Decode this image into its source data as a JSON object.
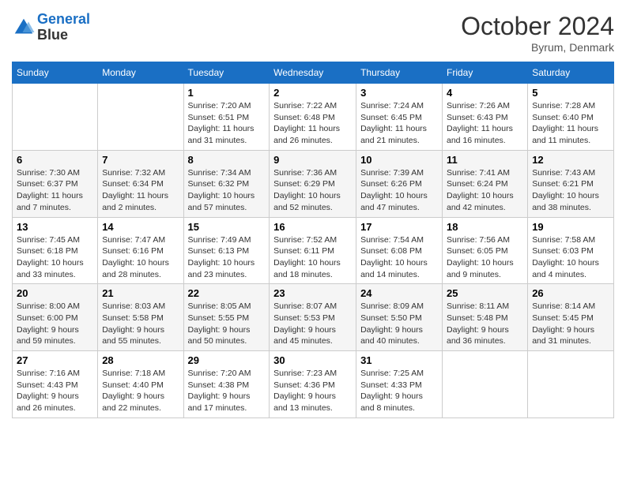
{
  "header": {
    "logo_line1": "General",
    "logo_line2": "Blue",
    "month_title": "October 2024",
    "location": "Byrum, Denmark"
  },
  "weekdays": [
    "Sunday",
    "Monday",
    "Tuesday",
    "Wednesday",
    "Thursday",
    "Friday",
    "Saturday"
  ],
  "weeks": [
    [
      {
        "day": "",
        "info": ""
      },
      {
        "day": "",
        "info": ""
      },
      {
        "day": "1",
        "info": "Sunrise: 7:20 AM\nSunset: 6:51 PM\nDaylight: 11 hours and 31 minutes."
      },
      {
        "day": "2",
        "info": "Sunrise: 7:22 AM\nSunset: 6:48 PM\nDaylight: 11 hours and 26 minutes."
      },
      {
        "day": "3",
        "info": "Sunrise: 7:24 AM\nSunset: 6:45 PM\nDaylight: 11 hours and 21 minutes."
      },
      {
        "day": "4",
        "info": "Sunrise: 7:26 AM\nSunset: 6:43 PM\nDaylight: 11 hours and 16 minutes."
      },
      {
        "day": "5",
        "info": "Sunrise: 7:28 AM\nSunset: 6:40 PM\nDaylight: 11 hours and 11 minutes."
      }
    ],
    [
      {
        "day": "6",
        "info": "Sunrise: 7:30 AM\nSunset: 6:37 PM\nDaylight: 11 hours and 7 minutes."
      },
      {
        "day": "7",
        "info": "Sunrise: 7:32 AM\nSunset: 6:34 PM\nDaylight: 11 hours and 2 minutes."
      },
      {
        "day": "8",
        "info": "Sunrise: 7:34 AM\nSunset: 6:32 PM\nDaylight: 10 hours and 57 minutes."
      },
      {
        "day": "9",
        "info": "Sunrise: 7:36 AM\nSunset: 6:29 PM\nDaylight: 10 hours and 52 minutes."
      },
      {
        "day": "10",
        "info": "Sunrise: 7:39 AM\nSunset: 6:26 PM\nDaylight: 10 hours and 47 minutes."
      },
      {
        "day": "11",
        "info": "Sunrise: 7:41 AM\nSunset: 6:24 PM\nDaylight: 10 hours and 42 minutes."
      },
      {
        "day": "12",
        "info": "Sunrise: 7:43 AM\nSunset: 6:21 PM\nDaylight: 10 hours and 38 minutes."
      }
    ],
    [
      {
        "day": "13",
        "info": "Sunrise: 7:45 AM\nSunset: 6:18 PM\nDaylight: 10 hours and 33 minutes."
      },
      {
        "day": "14",
        "info": "Sunrise: 7:47 AM\nSunset: 6:16 PM\nDaylight: 10 hours and 28 minutes."
      },
      {
        "day": "15",
        "info": "Sunrise: 7:49 AM\nSunset: 6:13 PM\nDaylight: 10 hours and 23 minutes."
      },
      {
        "day": "16",
        "info": "Sunrise: 7:52 AM\nSunset: 6:11 PM\nDaylight: 10 hours and 18 minutes."
      },
      {
        "day": "17",
        "info": "Sunrise: 7:54 AM\nSunset: 6:08 PM\nDaylight: 10 hours and 14 minutes."
      },
      {
        "day": "18",
        "info": "Sunrise: 7:56 AM\nSunset: 6:05 PM\nDaylight: 10 hours and 9 minutes."
      },
      {
        "day": "19",
        "info": "Sunrise: 7:58 AM\nSunset: 6:03 PM\nDaylight: 10 hours and 4 minutes."
      }
    ],
    [
      {
        "day": "20",
        "info": "Sunrise: 8:00 AM\nSunset: 6:00 PM\nDaylight: 9 hours and 59 minutes."
      },
      {
        "day": "21",
        "info": "Sunrise: 8:03 AM\nSunset: 5:58 PM\nDaylight: 9 hours and 55 minutes."
      },
      {
        "day": "22",
        "info": "Sunrise: 8:05 AM\nSunset: 5:55 PM\nDaylight: 9 hours and 50 minutes."
      },
      {
        "day": "23",
        "info": "Sunrise: 8:07 AM\nSunset: 5:53 PM\nDaylight: 9 hours and 45 minutes."
      },
      {
        "day": "24",
        "info": "Sunrise: 8:09 AM\nSunset: 5:50 PM\nDaylight: 9 hours and 40 minutes."
      },
      {
        "day": "25",
        "info": "Sunrise: 8:11 AM\nSunset: 5:48 PM\nDaylight: 9 hours and 36 minutes."
      },
      {
        "day": "26",
        "info": "Sunrise: 8:14 AM\nSunset: 5:45 PM\nDaylight: 9 hours and 31 minutes."
      }
    ],
    [
      {
        "day": "27",
        "info": "Sunrise: 7:16 AM\nSunset: 4:43 PM\nDaylight: 9 hours and 26 minutes."
      },
      {
        "day": "28",
        "info": "Sunrise: 7:18 AM\nSunset: 4:40 PM\nDaylight: 9 hours and 22 minutes."
      },
      {
        "day": "29",
        "info": "Sunrise: 7:20 AM\nSunset: 4:38 PM\nDaylight: 9 hours and 17 minutes."
      },
      {
        "day": "30",
        "info": "Sunrise: 7:23 AM\nSunset: 4:36 PM\nDaylight: 9 hours and 13 minutes."
      },
      {
        "day": "31",
        "info": "Sunrise: 7:25 AM\nSunset: 4:33 PM\nDaylight: 9 hours and 8 minutes."
      },
      {
        "day": "",
        "info": ""
      },
      {
        "day": "",
        "info": ""
      }
    ]
  ]
}
